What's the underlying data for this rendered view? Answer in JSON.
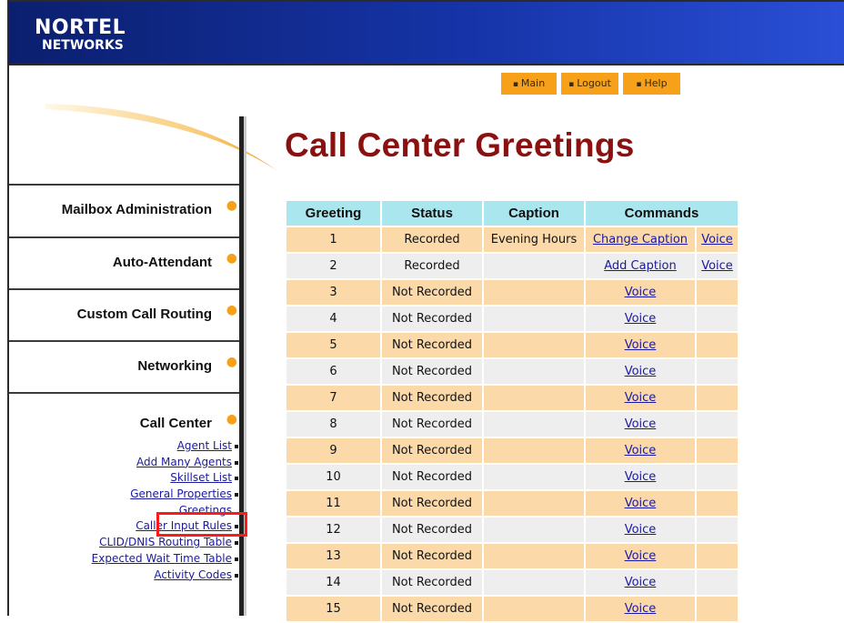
{
  "logo": {
    "line1": "NORTEL",
    "line2": "NETWORKS"
  },
  "topnav": {
    "main": "Main",
    "logout": "Logout",
    "help": "Help"
  },
  "title": "Call Center Greetings",
  "sidebar": {
    "items": [
      {
        "label": "Mailbox Administration"
      },
      {
        "label": "Auto-Attendant"
      },
      {
        "label": "Custom Call Routing"
      },
      {
        "label": "Networking"
      }
    ],
    "call_center": {
      "label": "Call Center",
      "links": [
        "Agent List",
        "Add Many Agents",
        "Skillset List",
        "General Properties",
        "Greetings",
        "Caller Input Rules",
        "CLID/DNIS Routing Table",
        "Expected Wait Time Table",
        "Activity Codes"
      ]
    }
  },
  "table": {
    "headers": [
      "Greeting",
      "Status",
      "Caption",
      "Commands"
    ],
    "rows": [
      {
        "greeting": "1",
        "status": "Recorded",
        "caption": "Evening Hours",
        "cmd": "Change Caption",
        "cmd2": "Voice"
      },
      {
        "greeting": "2",
        "status": "Recorded",
        "caption": "",
        "cmd": "Add Caption",
        "cmd2": "Voice"
      },
      {
        "greeting": "3",
        "status": "Not Recorded",
        "caption": "",
        "cmd": "Voice",
        "cmd2": ""
      },
      {
        "greeting": "4",
        "status": "Not Recorded",
        "caption": "",
        "cmd": "Voice",
        "cmd2": ""
      },
      {
        "greeting": "5",
        "status": "Not Recorded",
        "caption": "",
        "cmd": "Voice",
        "cmd2": ""
      },
      {
        "greeting": "6",
        "status": "Not Recorded",
        "caption": "",
        "cmd": "Voice",
        "cmd2": ""
      },
      {
        "greeting": "7",
        "status": "Not Recorded",
        "caption": "",
        "cmd": "Voice",
        "cmd2": ""
      },
      {
        "greeting": "8",
        "status": "Not Recorded",
        "caption": "",
        "cmd": "Voice",
        "cmd2": ""
      },
      {
        "greeting": "9",
        "status": "Not Recorded",
        "caption": "",
        "cmd": "Voice",
        "cmd2": ""
      },
      {
        "greeting": "10",
        "status": "Not Recorded",
        "caption": "",
        "cmd": "Voice",
        "cmd2": ""
      },
      {
        "greeting": "11",
        "status": "Not Recorded",
        "caption": "",
        "cmd": "Voice",
        "cmd2": ""
      },
      {
        "greeting": "12",
        "status": "Not Recorded",
        "caption": "",
        "cmd": "Voice",
        "cmd2": ""
      },
      {
        "greeting": "13",
        "status": "Not Recorded",
        "caption": "",
        "cmd": "Voice",
        "cmd2": ""
      },
      {
        "greeting": "14",
        "status": "Not Recorded",
        "caption": "",
        "cmd": "Voice",
        "cmd2": ""
      },
      {
        "greeting": "15",
        "status": "Not Recorded",
        "caption": "",
        "cmd": "Voice",
        "cmd2": ""
      }
    ]
  },
  "colors": {
    "header_blue": "#1634a8",
    "accent_orange": "#f7a11a",
    "title_red": "#8b1010",
    "table_header": "#a9e6ee",
    "row_orange": "#fbd9a9",
    "row_gray": "#eeeeee",
    "highlight_red": "#ff1a1a"
  }
}
